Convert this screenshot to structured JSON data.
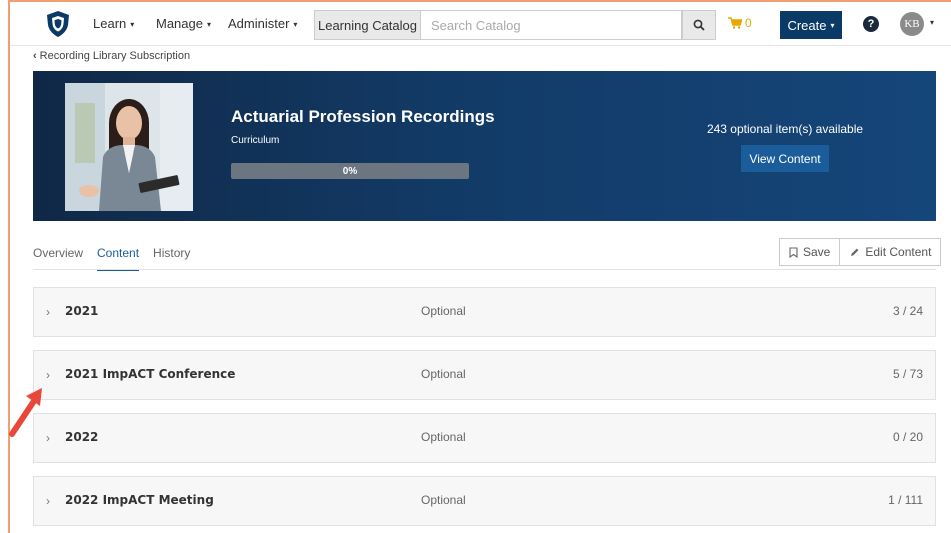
{
  "topnav": {
    "menus": [
      {
        "label": "Learn"
      },
      {
        "label": "Manage"
      },
      {
        "label": "Administer"
      }
    ],
    "catalog_label": "Learning Catalog",
    "search_placeholder": "Search Catalog",
    "cart_count": "0",
    "create_label": "Create",
    "help_label": "?",
    "avatar_initials": "KB"
  },
  "breadcrumb": {
    "label": "Recording Library Subscription"
  },
  "banner": {
    "title": "Actuarial Profession Recordings",
    "subtitle": "Curriculum",
    "progress_percent": 0,
    "progress_label": "0%",
    "available_text": "243 optional item(s) available",
    "view_button": "View Content"
  },
  "tabs": [
    {
      "label": "Overview",
      "active": false
    },
    {
      "label": "Content",
      "active": true
    },
    {
      "label": "History",
      "active": false
    }
  ],
  "actions": {
    "save_label": "Save",
    "edit_label": "Edit Content"
  },
  "rows": [
    {
      "name": "2021",
      "type": "Optional",
      "count": "3 / 24"
    },
    {
      "name": "2021 ImpACT Conference",
      "type": "Optional",
      "count": "5 / 73"
    },
    {
      "name": "2022",
      "type": "Optional",
      "count": "0 / 20"
    },
    {
      "name": "2022 ImpACT Meeting",
      "type": "Optional",
      "count": "1 / 111"
    }
  ],
  "colors": {
    "brand": "#0b3a66",
    "accent": "#1a5d9a",
    "annotation": "#e8473a",
    "cart": "#e8a800"
  }
}
